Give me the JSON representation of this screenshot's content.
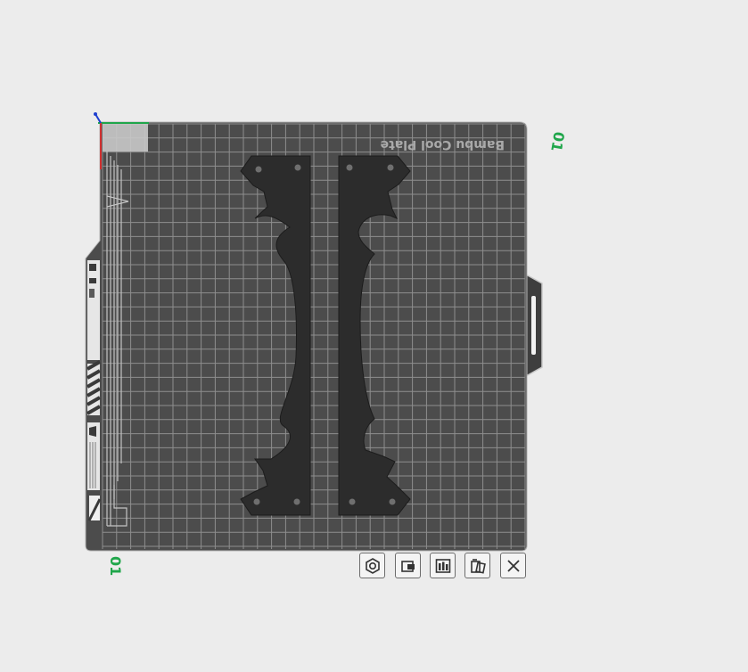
{
  "plate": {
    "name": "Bambu Cool Plate",
    "number_front": "01",
    "number_side": "01"
  },
  "toolbar": {
    "buttons": [
      {
        "name": "plate-settings-button",
        "icon": "gear-hexagon-icon"
      },
      {
        "name": "lock-plate-button",
        "icon": "lock-icon"
      },
      {
        "name": "arrange-button",
        "icon": "arrange-icon"
      },
      {
        "name": "auto-orient-button",
        "icon": "orient-icon"
      },
      {
        "name": "remove-plate-button",
        "icon": "close-icon"
      }
    ]
  },
  "colors": {
    "plate": "#4c4c4c",
    "grid": "#8e8e8e",
    "part": "#2c2c2c",
    "accent_green": "#1fa64a",
    "axis_x": "#1fa64a",
    "axis_y": "#1f3fcf",
    "axis_z": "#d23232"
  }
}
